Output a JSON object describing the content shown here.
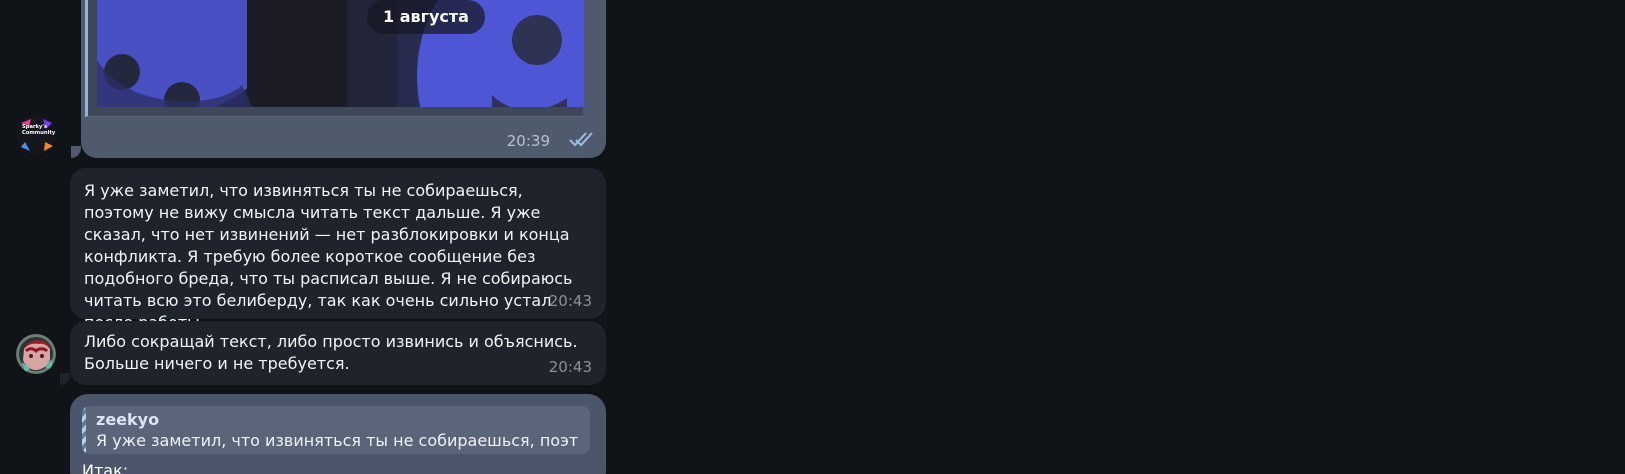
{
  "chat": {
    "date_label": "1 августа",
    "media_message": {
      "time": "20:39",
      "status": "read"
    },
    "messages": [
      {
        "text": "Я уже заметил, что извиняться ты не собираешься, поэтому не вижу смысла читать текст дальше. Я уже сказал, что нет извинений — нет разблокировки и конца конфликта. Я требую более короткое сообщение без подобного бреда, что ты расписал выше. Я не собираюсь читать всю это белиберду, так как очень сильно устал после работы.",
        "time": "20:43"
      },
      {
        "text": "Либо сокращай текст, либо просто извинись и объяснись. Больше ничего и не требуется.",
        "time": "20:43"
      }
    ],
    "reply_message": {
      "quoted_author": "zeekyo",
      "quoted_text": "Я уже заметил, что извиняться ты не собираешься, поэтому ...",
      "text": "Итак:"
    },
    "avatars": {
      "sparky_label": "Sparky's Community"
    }
  }
}
